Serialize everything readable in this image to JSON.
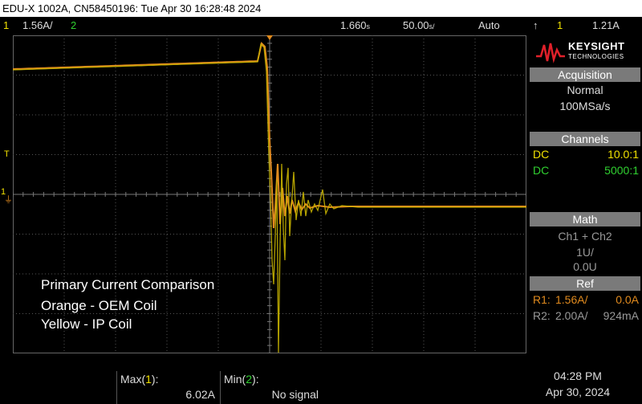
{
  "titlebar": {
    "text": "EDU-X 1002A, CN58450196: Tue Apr 30 16:28:48 2024"
  },
  "toprow": {
    "ch1_num": "1",
    "ch1_scale": "1.56A/",
    "ch2_num": "2",
    "time_pos": "1.660",
    "time_pos_unit": "s",
    "timebase": "50.00",
    "timebase_unit": "s/",
    "trigger_mode": "Auto",
    "trig_icon": "trigger-edge-icon",
    "trig_source": "1",
    "trig_level": "1.21A"
  },
  "colors": {
    "ch1": "#f0e000",
    "ch2": "#30d030",
    "ref1": "#e08a1e",
    "header_bg": "#7a7a7a"
  },
  "markers": {
    "trigger_marker": "T",
    "ch1_marker": "1",
    "ground_marker": "⏚"
  },
  "brand": {
    "name": "KEYSIGHT",
    "sub": "TECHNOLOGIES"
  },
  "panel": {
    "acquisition": {
      "header": "Acquisition",
      "mode": "Normal",
      "rate": "100MSa/s"
    },
    "channels": {
      "header": "Channels",
      "rows": [
        {
          "coupling": "DC",
          "value": "10.0:1"
        },
        {
          "coupling": "DC",
          "value": "5000:1"
        }
      ]
    },
    "math": {
      "header": "Math",
      "func": "Ch1 + Ch2",
      "scale": "1U/",
      "offset": "0.0U"
    },
    "ref": {
      "header": "Ref",
      "rows": [
        {
          "name": "R1:",
          "scale": "1.56A/",
          "offset": "0.0A"
        },
        {
          "name": "R2:",
          "scale": "2.00A/",
          "offset": "924mA"
        }
      ]
    }
  },
  "annotation": {
    "line1": "Primary Current Comparison",
    "line2": "Orange - OEM Coil",
    "line3": "Yellow - IP Coil"
  },
  "measurements": [
    {
      "label_prefix": "Max(",
      "label_ch": "1",
      "label_suffix": "):",
      "value": "6.02A"
    },
    {
      "label_prefix": "Min(",
      "label_ch": "2",
      "label_suffix": "):",
      "value": "No signal"
    }
  ],
  "clock": {
    "time": "04:28 PM",
    "date": "Apr 30, 2024"
  }
}
